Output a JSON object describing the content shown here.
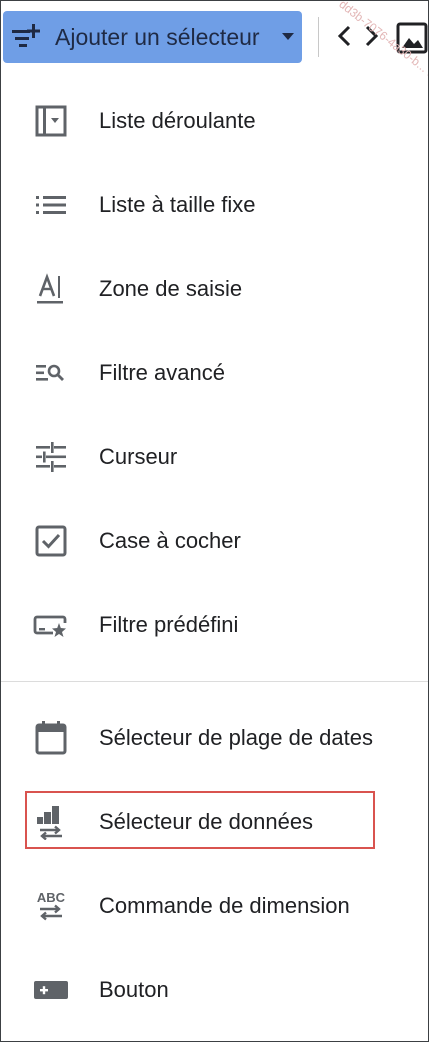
{
  "toolbar": {
    "add_control_label": "Ajouter un sélecteur",
    "add_control_icon": "add-filter-icon",
    "code_icon": "code-icon",
    "image_icon": "image-icon",
    "watermark": "dd3b-7076-4a30-b... tes"
  },
  "menu": {
    "items": [
      {
        "label": "Liste déroulante",
        "icon": "dropdown-list-icon"
      },
      {
        "label": "Liste à taille fixe",
        "icon": "fixed-size-list-icon"
      },
      {
        "label": "Zone de saisie",
        "icon": "input-box-icon"
      },
      {
        "label": "Filtre avancé",
        "icon": "advanced-filter-icon"
      },
      {
        "label": "Curseur",
        "icon": "slider-icon"
      },
      {
        "label": "Case à cocher",
        "icon": "checkbox-icon"
      },
      {
        "label": "Filtre prédéfini",
        "icon": "preset-filter-icon"
      },
      {
        "label": "Sélecteur de plage de dates",
        "icon": "calendar-icon"
      },
      {
        "label": "Sélecteur de données",
        "icon": "data-source-icon"
      },
      {
        "label": "Commande de dimension",
        "icon": "dimension-control-icon"
      },
      {
        "label": "Bouton",
        "icon": "button-icon"
      }
    ],
    "highlighted_item": "Sélecteur de données"
  },
  "colors": {
    "button_bg": "#6f9ee6",
    "icon": "#5f6368",
    "highlight_border": "#d9534f",
    "text": "#202124"
  }
}
